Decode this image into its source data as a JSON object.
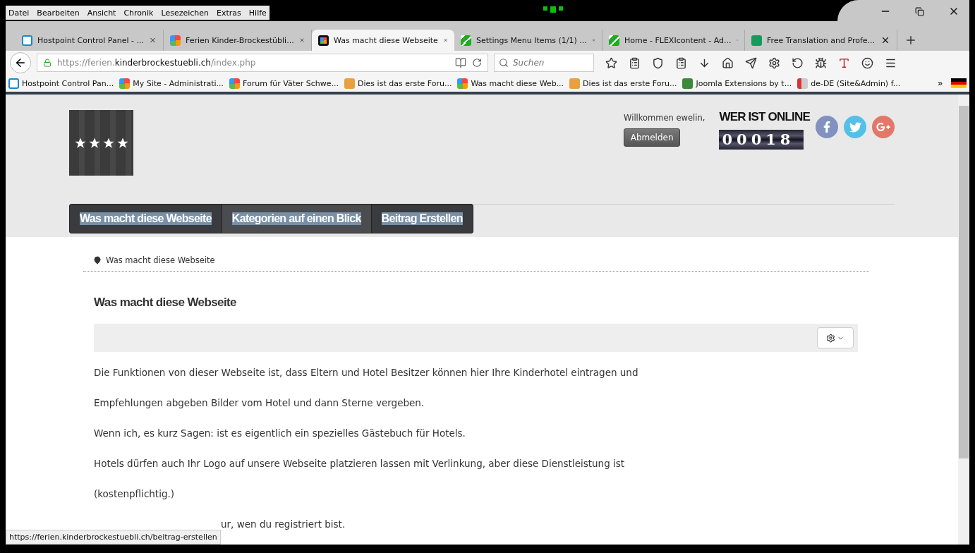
{
  "menu": [
    "Datei",
    "Bearbeiten",
    "Ansicht",
    "Chronik",
    "Lesezeichen",
    "Extras",
    "Hilfe"
  ],
  "tabs": [
    {
      "title": "Hostpoint Control Panel - ...",
      "kind": "page",
      "selected": false
    },
    {
      "title": "Ferien Kinder-Brockestübli...",
      "kind": "joomla",
      "selected": false
    },
    {
      "title": "Was macht diese Webseite",
      "kind": "joomla-dark",
      "selected": true
    },
    {
      "title": "Settings Menu Items (1/1) ...",
      "kind": "flexi",
      "selected": false
    },
    {
      "title": "Home - FLEXIcontent - Ad...",
      "kind": "flexi",
      "selected": false
    },
    {
      "title": "Free Translation and Profe...",
      "kind": "translate",
      "selected": false
    }
  ],
  "address": {
    "prefix": "https://ferien.",
    "domain": "kinderbrockestuebli.ch",
    "path": "/index.php"
  },
  "search": {
    "placeholder": "Suchen"
  },
  "bookmarks": [
    {
      "title": "Hostpoint Control Pan...",
      "kind": "page"
    },
    {
      "title": "My Site - Administrati...",
      "kind": "joomla"
    },
    {
      "title": "Forum für Väter Schwe...",
      "kind": "joomla"
    },
    {
      "title": "Dies ist das erste Foru...",
      "kind": "forum"
    },
    {
      "title": "Was macht diese Web...",
      "kind": "joomla"
    },
    {
      "title": "Dies ist das erste Foru...",
      "kind": "forum"
    },
    {
      "title": "Joomla Extensions by t...",
      "kind": "extensions"
    },
    {
      "title": "de-DE (Site&Admin) f...",
      "kind": "flag"
    }
  ],
  "bookmarks_more": "»",
  "site": {
    "welcome": "Willkommen ewelin,",
    "logout": "Abmelden",
    "online_title": "WER IST ONLINE",
    "counter": "00018",
    "nav": [
      {
        "label": "Was macht diese Webseite",
        "selected": false
      },
      {
        "label": "Kategorien auf einen Blick",
        "selected": true
      },
      {
        "label": "Beitrag Erstellen",
        "selected": false
      }
    ],
    "breadcrumb": "Was macht diese Webseite",
    "heading": "Was macht diese Webseite",
    "paragraphs": [
      "Die Funktionen von dieser Webseite ist, dass Eltern und Hotel Besitzer können hier Ihre Kinderhotel eintragen und",
      "Empfehlungen abgeben Bilder vom Hotel und dann Sterne vergeben.",
      "Wenn ich, es kurz Sagen: ist es eigentlich ein spezielles Gästebuch für Hotels.",
      "Hotels dürfen auch Ihr Logo auf unsere Webseite platzieren lassen mit Verlinkung, aber diese Dienstleistung ist",
      "(kostenpflichtig.)",
      "ur, wen du registriert bist."
    ]
  },
  "status_link": "https://ferien.kinderbrockestuebli.ch/beitrag-erstellen"
}
